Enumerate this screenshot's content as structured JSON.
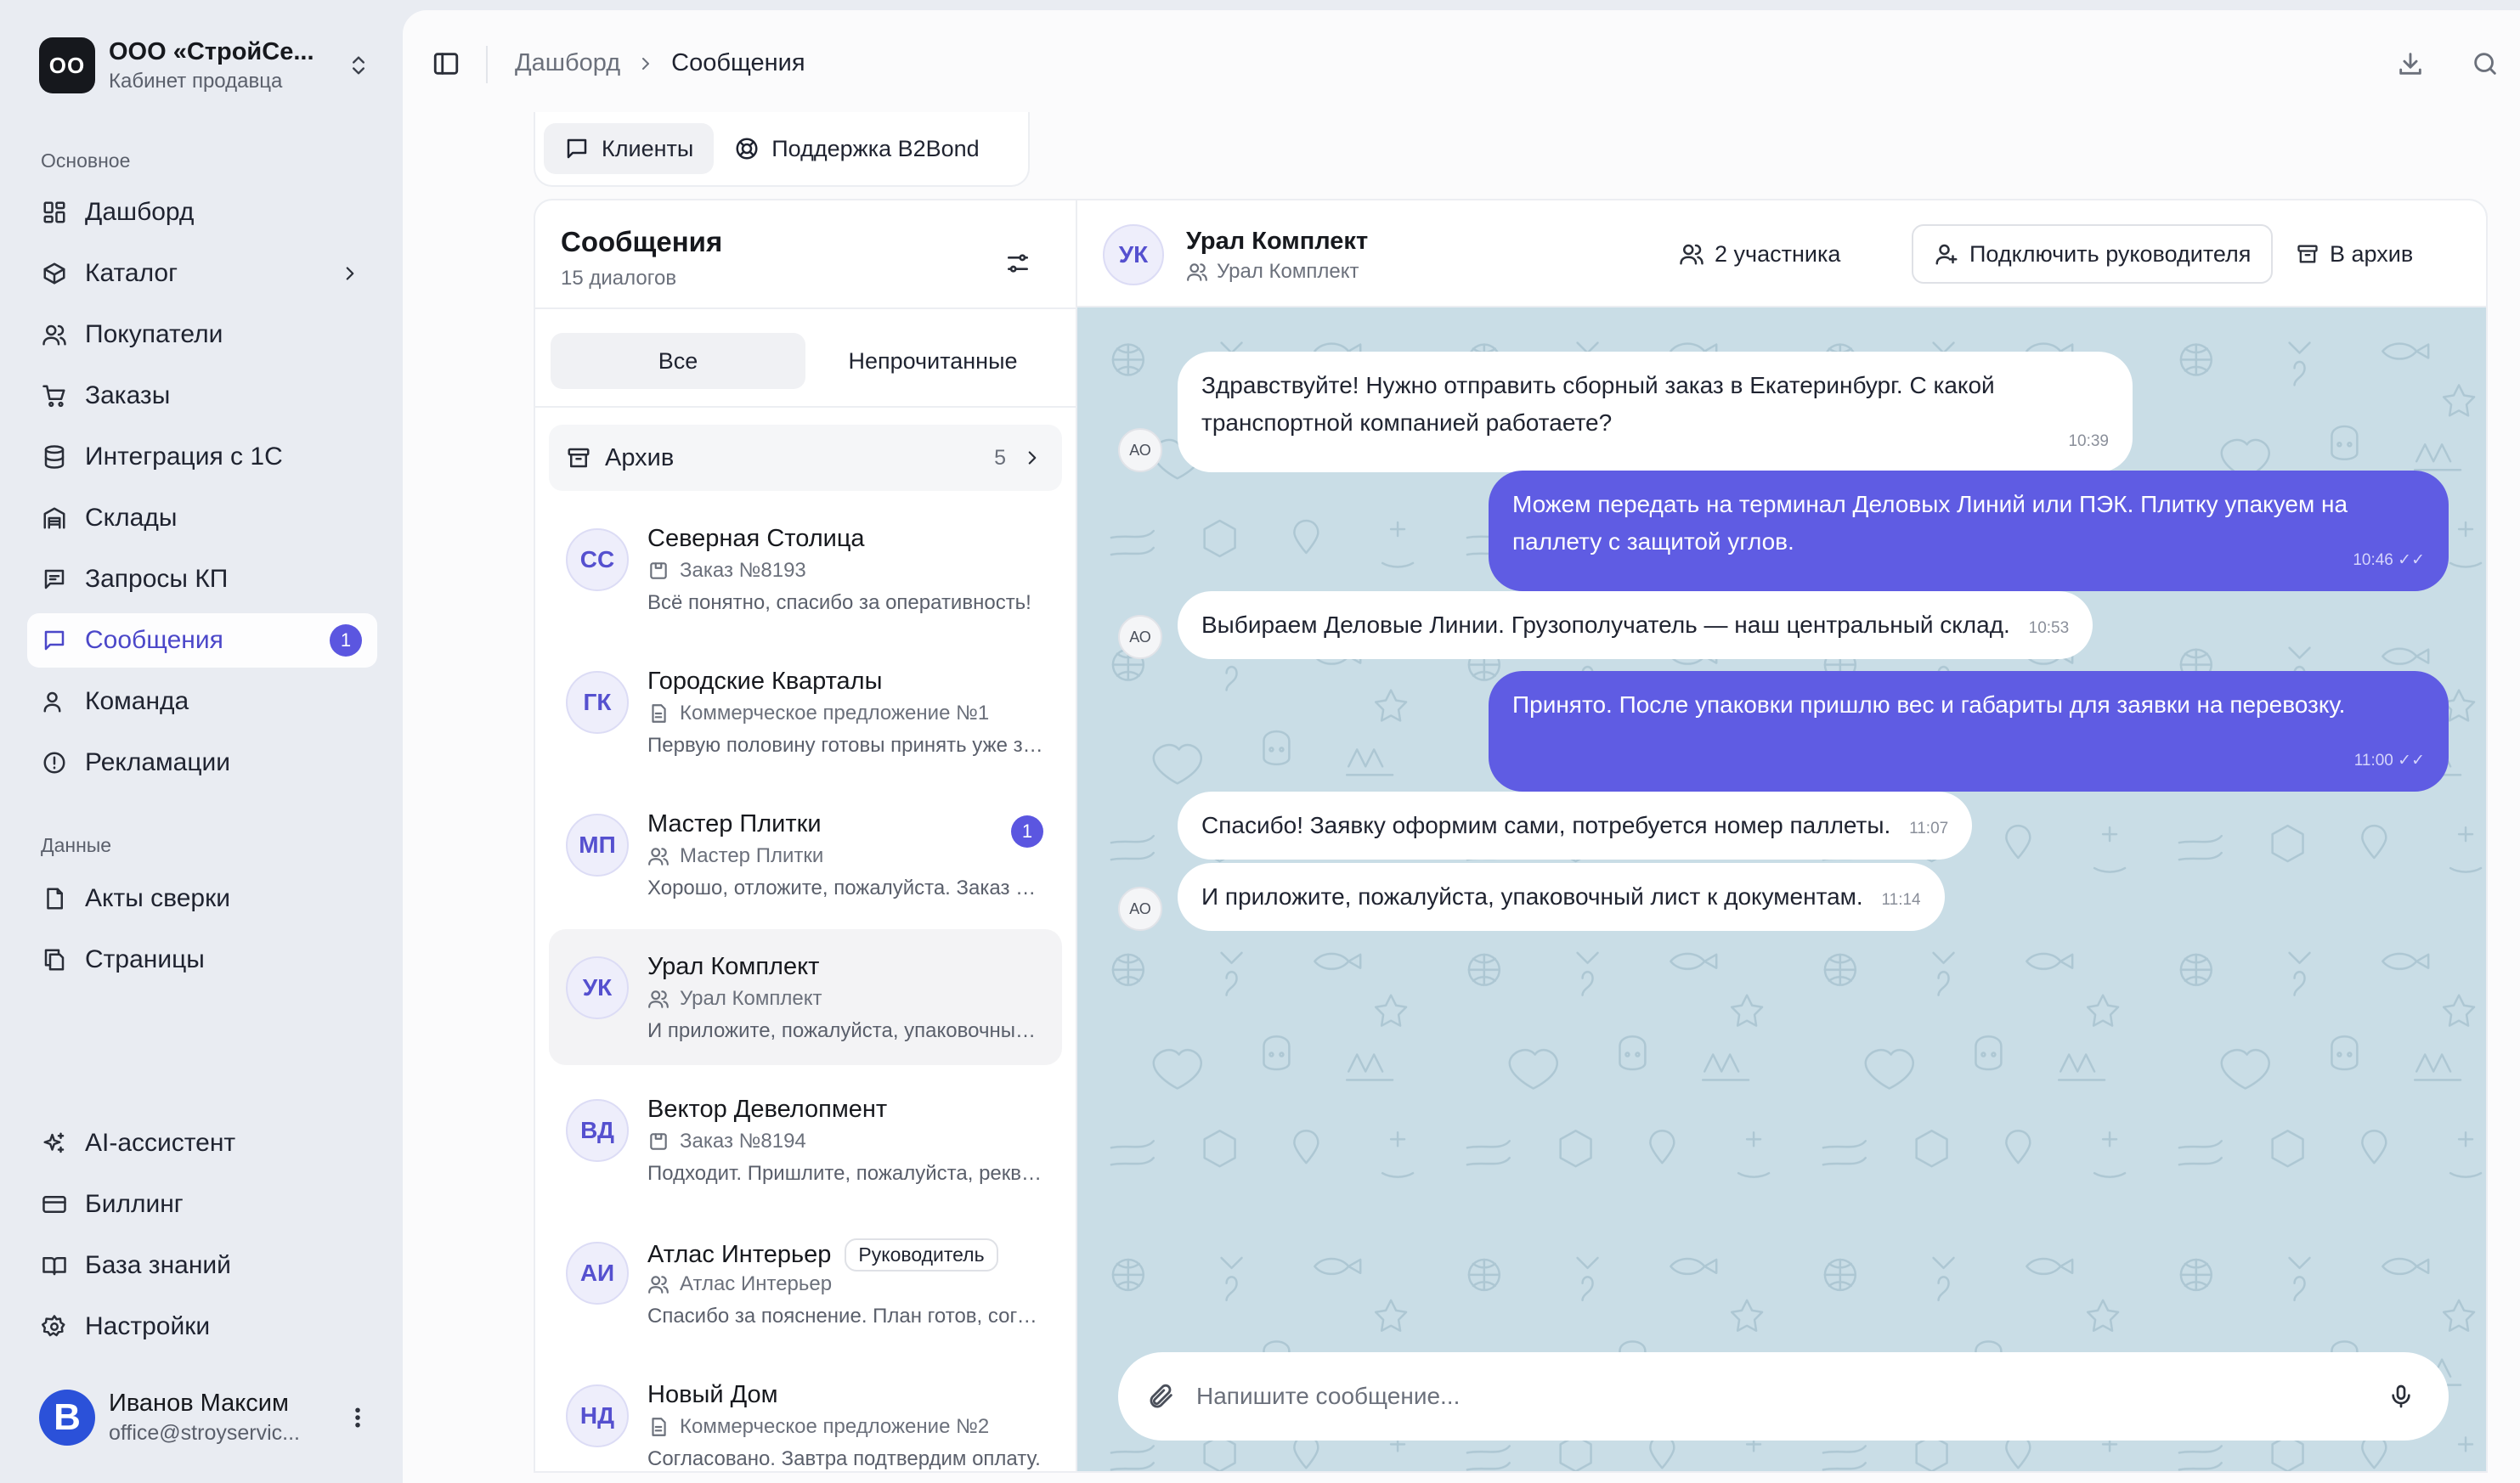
{
  "org": {
    "logo": "OO",
    "name": "ООО «СтройСе...",
    "subtitle": "Кабинет продавца"
  },
  "sidebar": {
    "section_main": "Основное",
    "main_items": [
      {
        "label": "Дашборд",
        "icon": "dashboard-icon"
      },
      {
        "label": "Каталог",
        "icon": "box-icon"
      },
      {
        "label": "Покупатели",
        "icon": "users-icon"
      },
      {
        "label": "Заказы",
        "icon": "cart-icon"
      },
      {
        "label": "Интеграция с 1С",
        "icon": "database-icon"
      },
      {
        "label": "Склады",
        "icon": "warehouse-icon"
      },
      {
        "label": "Запросы КП",
        "icon": "request-icon"
      },
      {
        "label": "Сообщения",
        "icon": "message-icon",
        "badge": "1"
      },
      {
        "label": "Команда",
        "icon": "team-icon"
      },
      {
        "label": "Рекламации",
        "icon": "alert-icon"
      }
    ],
    "section_data": "Данные",
    "data_items": [
      {
        "label": "Акты сверки",
        "icon": "document-icon"
      },
      {
        "label": "Страницы",
        "icon": "pages-icon"
      }
    ],
    "bottom_items": [
      {
        "label": "AI-ассистент",
        "icon": "sparkles-icon"
      },
      {
        "label": "Биллинг",
        "icon": "card-icon"
      },
      {
        "label": "База знаний",
        "icon": "book-icon"
      },
      {
        "label": "Настройки",
        "icon": "gear-icon"
      }
    ]
  },
  "user": {
    "avatar": "B",
    "name": "Иванов Максим",
    "email": "office@stroyservic..."
  },
  "breadcrumb": {
    "parent": "Дашборд",
    "current": "Сообщения"
  },
  "tabs": [
    {
      "label": "Клиенты",
      "icon": "chat-icon"
    },
    {
      "label": "Поддержка B2Bond",
      "icon": "lifebuoy-icon"
    }
  ],
  "list": {
    "title": "Сообщения",
    "count": "15 диалогов",
    "filter_all": "Все",
    "filter_unread": "Непрочитанные",
    "archive_label": "Архив",
    "archive_count": "5",
    "conversations": [
      {
        "initials": "СС",
        "name": "Северная Столица",
        "meta": "Заказ №8193",
        "meta_icon": "order-icon",
        "preview": "Всё понятно, спасибо за оперативность!"
      },
      {
        "initials": "ГК",
        "name": "Городские Кварталы",
        "meta": "Коммерческое предложение №1",
        "meta_icon": "file-icon",
        "preview": "Первую половину готовы принять уже завтра."
      },
      {
        "initials": "МП",
        "name": "Мастер Плитки",
        "meta": "Мастер Плитки",
        "meta_icon": "users-icon",
        "preview": "Хорошо, отложите, пожалуйста. Заказ оформим.",
        "unread": "1"
      },
      {
        "initials": "УК",
        "name": "Урал Комплект",
        "meta": "Урал Комплект",
        "meta_icon": "users-icon",
        "preview": "И приложите, пожалуйста, упаковочный лист."
      },
      {
        "initials": "ВД",
        "name": "Вектор Девелопмент",
        "meta": "Заказ №8194",
        "meta_icon": "order-icon",
        "preview": "Подходит. Пришлите, пожалуйста, реквизиты."
      },
      {
        "initials": "АИ",
        "name": "Атлас Интерьер",
        "tag": "Руководитель",
        "meta": "Атлас Интерьер",
        "meta_icon": "users-icon",
        "preview": "Спасибо за пояснение. План готов, согласуем."
      },
      {
        "initials": "НД",
        "name": "Новый Дом",
        "meta": "Коммерческое предложение №2",
        "meta_icon": "file-icon",
        "preview": "Согласовано. Завтра подтвердим оплату."
      }
    ]
  },
  "chat": {
    "initials": "УК",
    "title": "Урал Комплект",
    "subtitle": "Урал Комплект",
    "participants": "2 участника",
    "connect_manager": "Подключить руководителя",
    "archive": "В архив",
    "messages": [
      {
        "from": "in",
        "avatar": "АО",
        "text": "Здравствуйте! Нужно отправить сборный заказ в Екатеринбург. С какой транспортной компанией работаете?",
        "time": "10:39"
      },
      {
        "from": "out",
        "text": "Можем передать на терминал Деловых Линий или ПЭК. Плитку упакуем на паллету с защитой углов.",
        "time": "10:46"
      },
      {
        "from": "in",
        "avatar": "АО",
        "text": "Выбираем Деловые Линии. Грузополучатель — наш центральный склад.",
        "time": "10:53"
      },
      {
        "from": "out",
        "text": "Принято. После упаковки пришлю вес и габариты для заявки на перевозку.",
        "time": "11:00"
      },
      {
        "from": "in",
        "avatar": "АО",
        "text": "Спасибо! Заявку оформим сами, потребуется номер паллеты.",
        "time": "11:07"
      },
      {
        "from": "in",
        "avatar": "АО",
        "text": "И приложите, пожалуйста, упаковочный лист к документам.",
        "time": "11:14"
      }
    ],
    "composer_placeholder": "Напишите сообщение..."
  },
  "colors": {
    "accent": "#5f5ce3",
    "chat_bg": "#c9dde6",
    "badge": "#5b56e0"
  }
}
